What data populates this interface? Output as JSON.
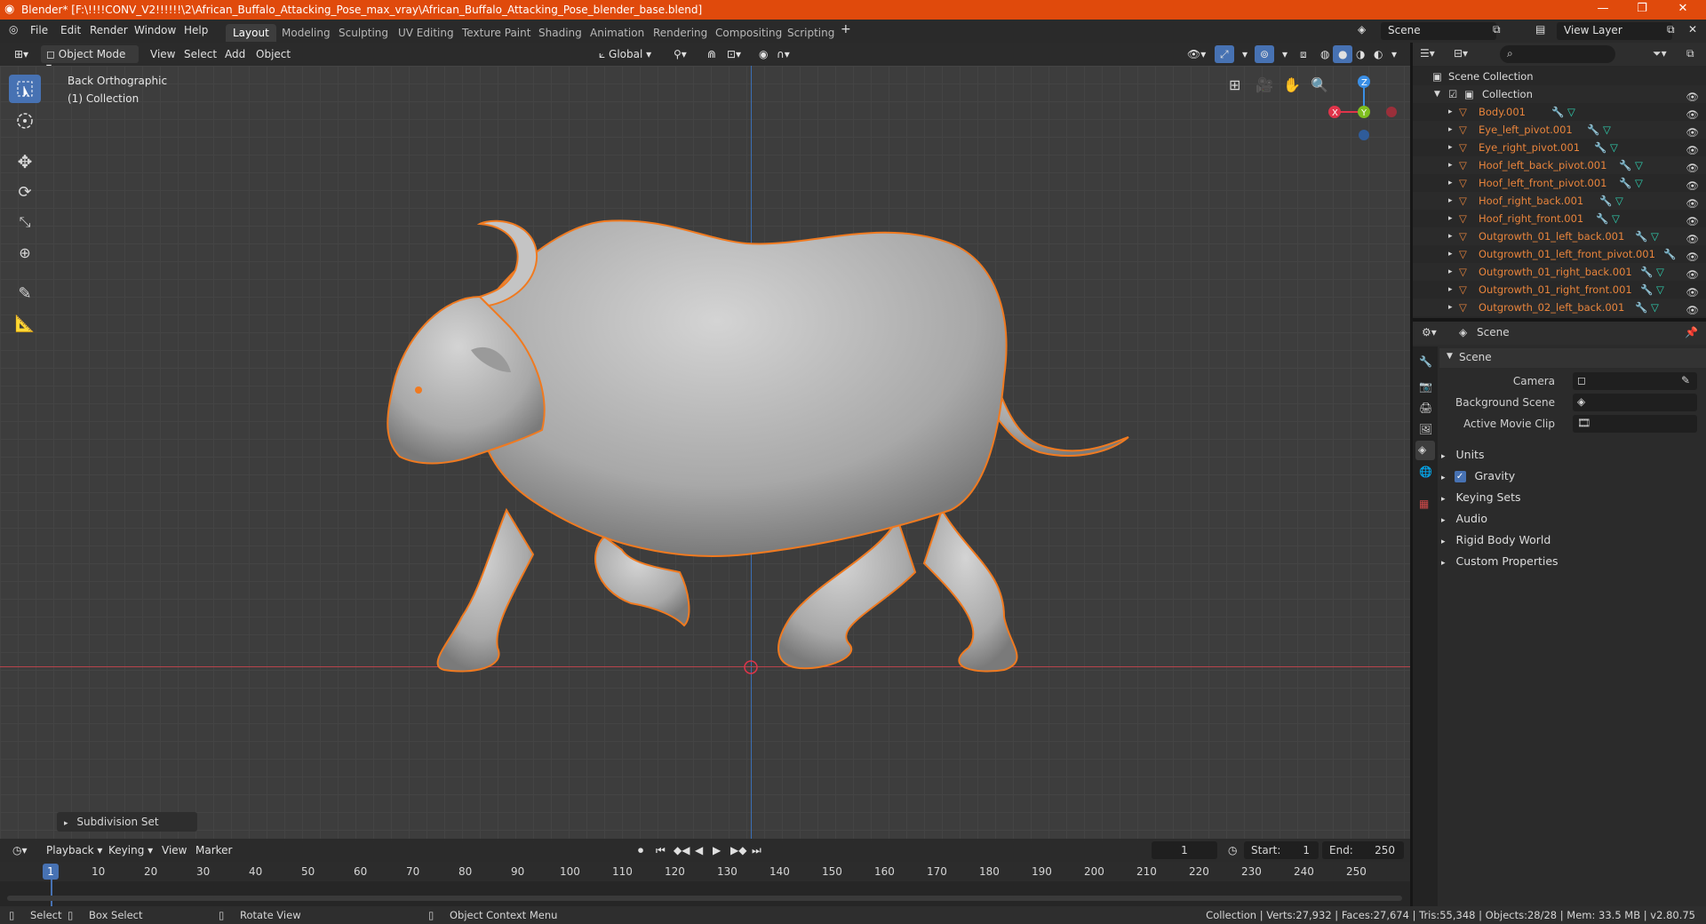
{
  "window": {
    "title": "Blender* [F:\\!!!!CONV_V2!!!!!!\\2\\African_Buffalo_Attacking_Pose_max_vray\\African_Buffalo_Attacking_Pose_blender_base.blend]",
    "minimize": "—",
    "maximize": "❐",
    "close": "✕"
  },
  "menu": {
    "items": [
      "File",
      "Edit",
      "Render",
      "Window",
      "Help"
    ]
  },
  "workspaces": [
    "Layout",
    "Modeling",
    "Sculpting",
    "UV Editing",
    "Texture Paint",
    "Shading",
    "Animation",
    "Rendering",
    "Compositing",
    "Scripting"
  ],
  "workspace_active": "Layout",
  "scene_selector": {
    "label": "Scene",
    "view_layer": "View Layer"
  },
  "viewport": {
    "mode": "Object Mode",
    "menus": [
      "View",
      "Select",
      "Add",
      "Object"
    ],
    "orientation": "Global",
    "view_name": "Back Orthographic",
    "collection_label": "(1) Collection",
    "operator_panel": "Subdivision Set"
  },
  "gizmo": {
    "x": "X",
    "y": "Y",
    "z": "Z"
  },
  "outliner": {
    "root": "Scene Collection",
    "collection": "Collection",
    "items": [
      "Body.001",
      "Eye_left_pivot.001",
      "Eye_right_pivot.001",
      "Hoof_left_back_pivot.001",
      "Hoof_left_front_pivot.001",
      "Hoof_right_back.001",
      "Hoof_right_front.001",
      "Outgrowth_01_left_back.001",
      "Outgrowth_01_left_front_pivot.001",
      "Outgrowth_01_right_back.001",
      "Outgrowth_01_right_front.001",
      "Outgrowth_02_left_back.001"
    ]
  },
  "properties": {
    "context": "Scene",
    "section": "Scene",
    "camera_label": "Camera",
    "background_scene_label": "Background Scene",
    "active_clip_label": "Active Movie Clip",
    "panels": [
      "Units",
      "Gravity",
      "Keying Sets",
      "Audio",
      "Rigid Body World",
      "Custom Properties"
    ],
    "gravity_checked": true
  },
  "timeline": {
    "menus": [
      "Playback",
      "Keying",
      "View",
      "Marker"
    ],
    "current_frame": "1",
    "start_label": "Start:",
    "start": "1",
    "end_label": "End:",
    "end": "250",
    "ticks": [
      "1",
      "10",
      "20",
      "30",
      "40",
      "50",
      "60",
      "70",
      "80",
      "90",
      "100",
      "110",
      "120",
      "130",
      "140",
      "150",
      "160",
      "170",
      "180",
      "190",
      "200",
      "210",
      "220",
      "230",
      "240",
      "250"
    ]
  },
  "status": {
    "select": "Select",
    "box_select": "Box Select",
    "rotate": "Rotate View",
    "context_menu": "Object Context Menu",
    "stats": "Collection | Verts:27,932 | Faces:27,674 | Tris:55,348 | Objects:28/28 | Mem: 33.5 MB | v2.80.75"
  },
  "colors": {
    "accent": "#e04a0c",
    "selection": "#f07a20",
    "active_tab": "#4772b3",
    "x_axis": "#e0344a",
    "y_axis": "#7fbf1f",
    "z_axis": "#3a8fe6"
  }
}
